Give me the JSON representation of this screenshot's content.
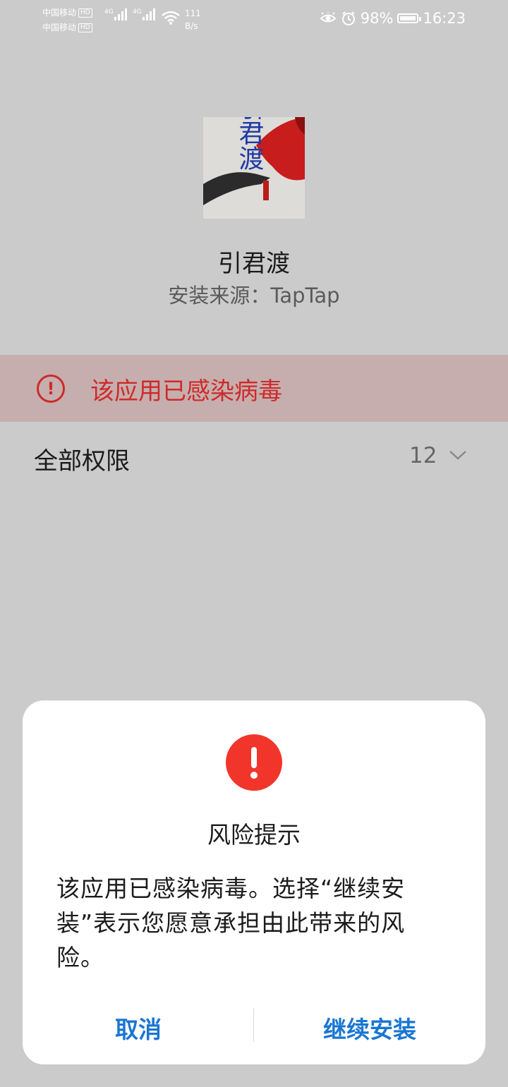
{
  "status_bar": {
    "carrier_1": "中国移动",
    "carrier_2": "中国移动",
    "hd_badge": "HD",
    "network_type": "4G",
    "net_speed_value": "111",
    "net_speed_unit": "B/s",
    "battery": "98%",
    "battery_level_percent": 98,
    "time": "16:23",
    "icons": [
      "eye-comfort-icon",
      "alarm-icon",
      "battery-icon",
      "wifi-icon",
      "signal-icon"
    ]
  },
  "app": {
    "icon_text": "引君渡",
    "name": "引君渡",
    "source": "安装来源：TapTap"
  },
  "warning_banner": {
    "text": "该应用已感染病毒",
    "color": "#cf2a2a"
  },
  "permissions": {
    "label": "全部权限",
    "count": "12"
  },
  "dialog": {
    "title": "风险提示",
    "message": "该应用已感染病毒。选择“继续安装”表示您愿意承担由此带来的风险。",
    "cancel_label": "取消",
    "continue_label": "继续安装",
    "accent_color": "#1976d2",
    "alert_color": "#f2352b"
  }
}
